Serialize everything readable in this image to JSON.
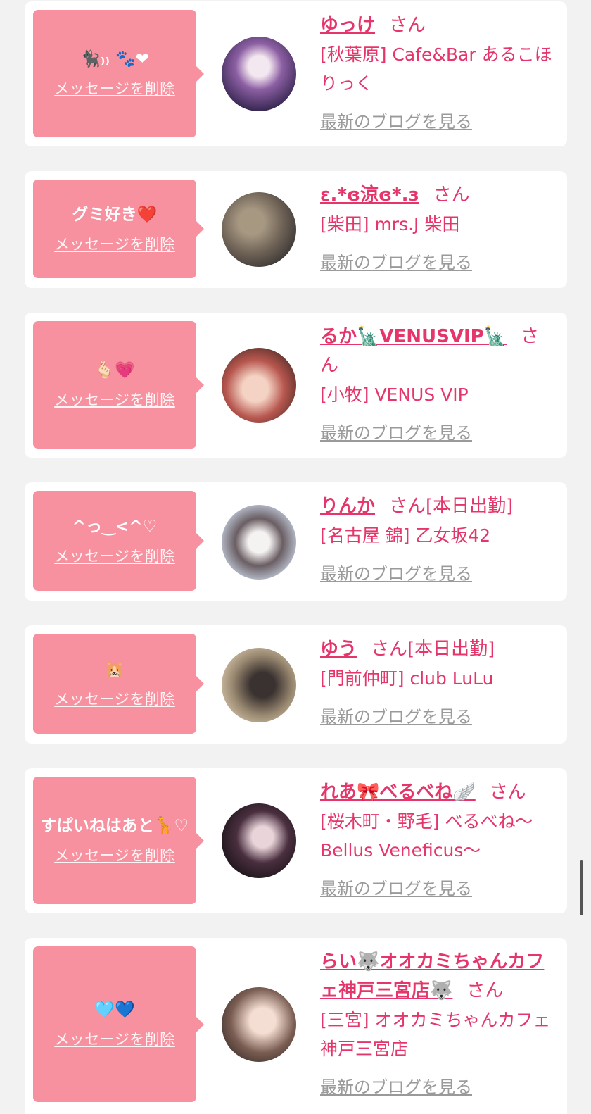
{
  "colors": {
    "accent": "#e5356a",
    "bubble": "#f7919f",
    "page_bg": "#f2f2f2",
    "link_gray": "#9a9a9a"
  },
  "labels": {
    "delete": "メッセージを削除",
    "blog": "最新のブログを見る",
    "honorific": "さん"
  },
  "entries": [
    {
      "message": "🐈‍⬛₎₎ 🐾❤",
      "name": "ゆっけ",
      "attend": "",
      "shop": "[秋葉原] Cafe&Bar あるこほりっく",
      "avatar_icon": "avatar-photo"
    },
    {
      "message": "グミ好き❤️",
      "name": "ε.*ɞ涼ɞ*.з",
      "attend": "",
      "shop": "[柴田] mrs.J 柴田",
      "avatar_icon": "avatar-photo"
    },
    {
      "message": "🫰🏻💗",
      "name": "るか🗽VENUSVIP🗽",
      "attend": "",
      "shop": "[小牧] VENUS VIP",
      "avatar_icon": "avatar-photo"
    },
    {
      "message": "^っ‿<^♡",
      "name": "りんか",
      "attend": "[本日出勤]",
      "shop": "[名古屋 錦] 乙女坂42",
      "avatar_icon": "avatar-photo"
    },
    {
      "message": "🐹",
      "name": "ゆう",
      "attend": "[本日出勤]",
      "shop": "[門前仲町] club LuLu",
      "avatar_icon": "avatar-photo"
    },
    {
      "message": "すぱいねはあと🦒♡",
      "name": "れあ🎀べるべね🪽",
      "attend": "",
      "shop": "[桜木町・野毛] べるべね〜Bellus Veneficus〜",
      "avatar_icon": "avatar-photo"
    },
    {
      "message": "🩵💙",
      "name": "らい🐺オオカミちゃんカフェ神戸三宮店🐺",
      "attend": "",
      "shop": "[三宮] オオカミちゃんカフェ神戸三宮店",
      "avatar_icon": "avatar-photo"
    }
  ]
}
